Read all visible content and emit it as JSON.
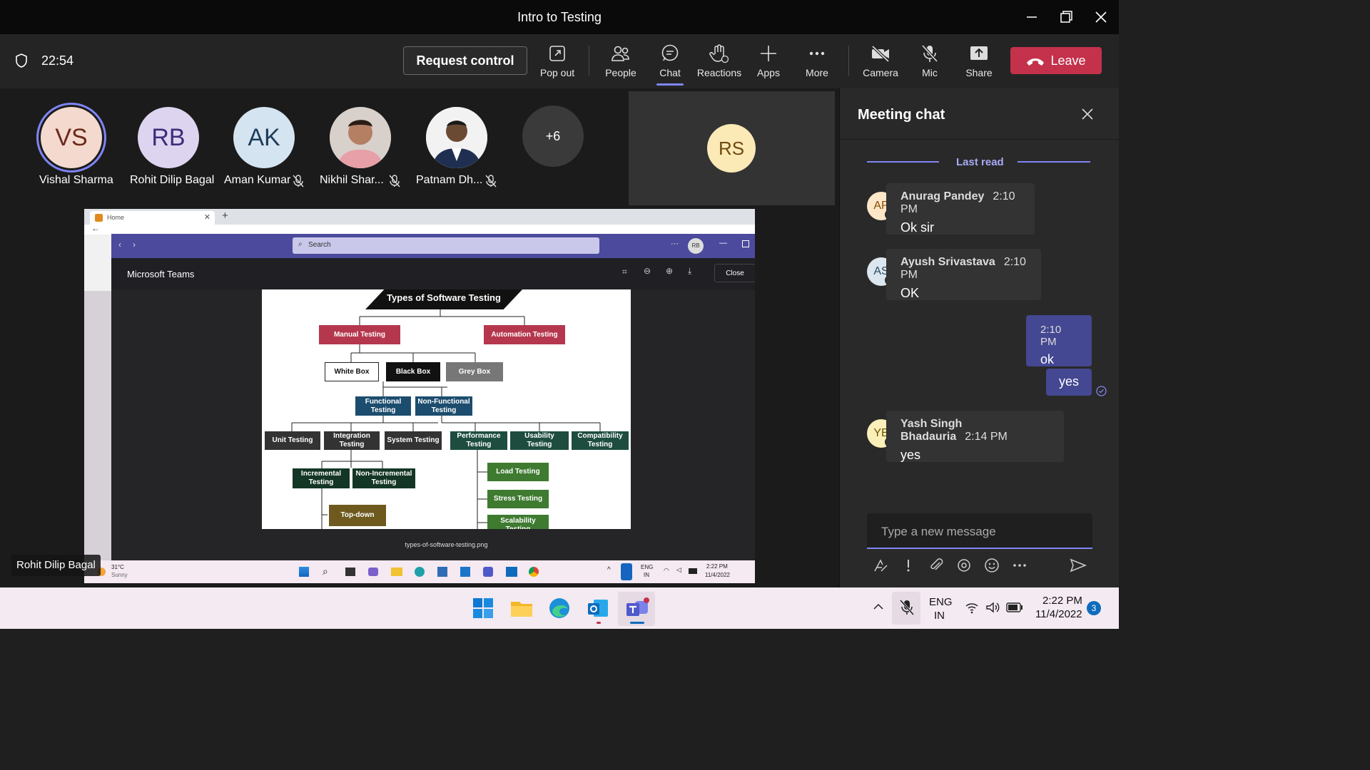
{
  "window": {
    "title": "Intro to Testing"
  },
  "toolbar": {
    "time": "22:54",
    "request_control": "Request control",
    "pop_out": "Pop out",
    "people": "People",
    "chat": "Chat",
    "reactions": "Reactions",
    "apps": "Apps",
    "more": "More",
    "camera": "Camera",
    "mic": "Mic",
    "share": "Share",
    "leave": "Leave"
  },
  "participants": [
    {
      "initials": "VS",
      "name": "Vishal Sharma",
      "color": "#f4d9cf"
    },
    {
      "initials": "RB",
      "name": "Rohit Dilip Bagal",
      "color": "#ddd5f0"
    },
    {
      "initials": "AK",
      "name": "Aman Kumar",
      "color": "#d5e4f1"
    },
    {
      "initials": "",
      "name": "Nikhil Shar..."
    },
    {
      "initials": "",
      "name": "Patnam Dh..."
    }
  ],
  "overflow_count": "+6",
  "self_tile": {
    "initials": "RS",
    "color": "#fbe9b6"
  },
  "presenter_label": "Rohit Dilip Bagal",
  "chat": {
    "title": "Meeting chat",
    "last_read": "Last read",
    "messages": [
      {
        "initials": "AP",
        "name": "Anurag Pandey",
        "time": "2:10 PM",
        "text": "Ok sir",
        "color": "#fde7c9"
      },
      {
        "initials": "AS",
        "name": "Ayush Srivastava",
        "time": "2:10 PM",
        "text": "OK",
        "color": "#dbe6ee"
      },
      {
        "time": "2:10 PM",
        "text": "ok"
      },
      {
        "text": "yes"
      },
      {
        "initials": "YB",
        "name": "Yash Singh Bhadauria",
        "time": "2:14 PM",
        "text": "yes",
        "color": "#fbefb9"
      }
    ],
    "compose_placeholder": "Type a new message"
  },
  "shared": {
    "browser_tab": "Home",
    "teams_search": "Search",
    "teams_avatar": "RB",
    "viewer_title": "Microsoft Teams",
    "close_label": "Close",
    "file_caption": "types-of-software-testing.png",
    "weather_temp": "31°C",
    "weather_desc": "Sunny",
    "inner_lang1": "ENG",
    "inner_lang2": "IN",
    "inner_time": "2:22 PM",
    "inner_date": "11/4/2022"
  },
  "diagram": {
    "title": "Types of Software Testing",
    "manual": "Manual Testing",
    "automation": "Automation Testing",
    "white": "White Box",
    "black": "Black Box",
    "grey": "Grey Box",
    "functional": "Functional Testing",
    "nonfunctional": "Non-Functional Testing",
    "unit": "Unit Testing",
    "integration": "Integration Testing",
    "system": "System Testing",
    "performance": "Performance Testing",
    "usability": "Usability Testing",
    "compatibility": "Compatibility Testing",
    "incremental": "Incremental Testing",
    "nonincremental": "Non-Incremental Testing",
    "topdown": "Top-down",
    "load": "Load Testing",
    "stress": "Stress Testing",
    "scalability": "Scalability Testing"
  },
  "taskbar": {
    "lang1": "ENG",
    "lang2": "IN",
    "time": "2:22 PM",
    "date": "11/4/2022",
    "notif_count": "3"
  }
}
